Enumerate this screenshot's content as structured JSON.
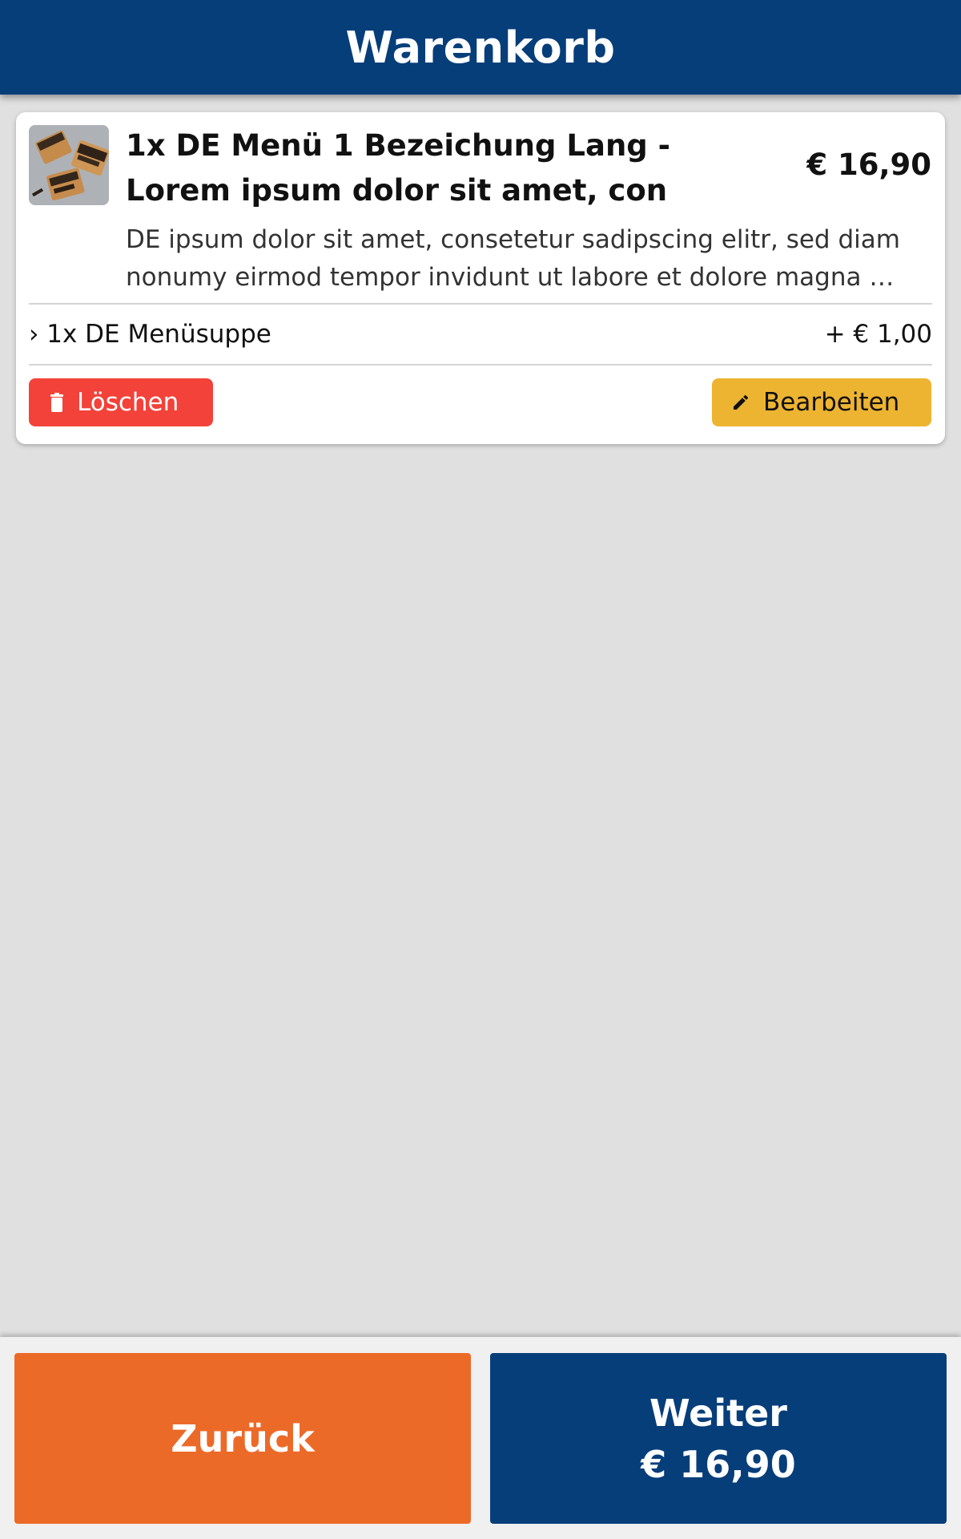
{
  "header": {
    "title": "Warenkorb"
  },
  "cart": {
    "items": [
      {
        "title": "1x DE Menü 1 Bezeichung Lang - Lorem ipsum dolor sit amet, con",
        "price": "€ 16,90",
        "description_line1": "DE ipsum dolor sit amet, consetetur sadipscing elitr, sed diam",
        "description_line2": "nonumy eirmod tempor invidunt ut labore et dolore magna …",
        "sub_items": [
          {
            "label": "› 1x DE Menüsuppe",
            "price": "+ € 1,00"
          }
        ],
        "delete_label": "Löschen",
        "edit_label": "Bearbeiten"
      }
    ]
  },
  "footer": {
    "back_label": "Zurück",
    "next_label": "Weiter",
    "next_total": "€ 16,90"
  },
  "colors": {
    "primary": "#063e7a",
    "back_button": "#ec6a28",
    "delete_button": "#f2423a",
    "edit_button": "#edb432",
    "background": "#e0e0e0"
  },
  "icons": {
    "delete": "trash-icon",
    "edit": "pencil-icon"
  }
}
